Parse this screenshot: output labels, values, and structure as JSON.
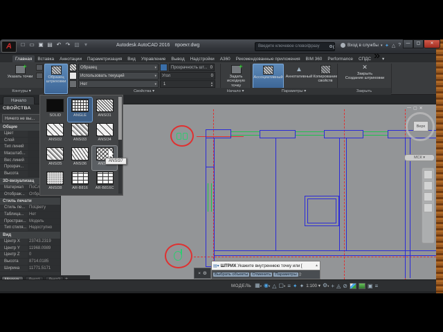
{
  "colors": {
    "accent_blue": "#4c7fb5",
    "axis_red": "#e03030",
    "wall_blue": "#2a2ad8",
    "window_green": "#1fc24d",
    "canvas_gray": "#939597"
  },
  "titlebar": {
    "app_letter": "A",
    "title": "Autodesk AutoCAD 2016",
    "filename": "проект.dwg",
    "search_placeholder": "Введите ключевое слово/фразу",
    "signin_label": "Вход в службы"
  },
  "ribbon_tabs": [
    {
      "label": "Главная",
      "active": true
    },
    {
      "label": "Вставка"
    },
    {
      "label": "Аннотации"
    },
    {
      "label": "Параметризация"
    },
    {
      "label": "Вид"
    },
    {
      "label": "Управление"
    },
    {
      "label": "Вывод"
    },
    {
      "label": "Надстройки"
    },
    {
      "label": "A360"
    },
    {
      "label": "Рекомендованные приложения"
    },
    {
      "label": "BIM 360"
    },
    {
      "label": "Performance"
    },
    {
      "label": "СПДС"
    }
  ],
  "ribbon": {
    "pick_points": "Указать точки",
    "contours_panel": "Контуры",
    "pattern_button": "Образец штриховки",
    "pattern_dropdown": "Образец",
    "use_current": "Использовать текущий",
    "none_option": "Нет",
    "transparency_label": "Прозрачность шт...",
    "transparency_value": "0",
    "angle_label": "Угол",
    "angle_value": "0",
    "scale_value": "1",
    "properties_panel": "Свойства",
    "set_origin": "Задать исходную точку",
    "origin_panel": "Начало",
    "associative": "Ассоциативный",
    "annotative": "Аннотативный",
    "match_properties": "Копирование свойств",
    "options_panel": "Параметры",
    "close_line1": "Закрыть",
    "close_line2": "Создание штриховки",
    "close_panel": "Закрыть"
  },
  "file_tabs": {
    "start_tab": "Начало"
  },
  "gallery": {
    "tooltip": "ANSI37",
    "items": [
      {
        "label": "SOLID",
        "pattern": "solid"
      },
      {
        "label": "ANGLE",
        "pattern": "grid",
        "selected": true
      },
      {
        "label": "ANSI31",
        "pattern": "diag1"
      },
      {
        "label": "ANSI32",
        "pattern": "diag2"
      },
      {
        "label": "ANSI33",
        "pattern": "diag3"
      },
      {
        "label": "ANSI34",
        "pattern": "diag4"
      },
      {
        "label": "ANSI35",
        "pattern": "diag3"
      },
      {
        "label": "ANSI36",
        "pattern": "diag5"
      },
      {
        "label": "ANSI37",
        "pattern": "cross",
        "hovered": true
      },
      {
        "label": "ANSI38",
        "pattern": "dots"
      },
      {
        "label": "AR-B816",
        "pattern": "brick"
      },
      {
        "label": "AR-B816C",
        "pattern": "brick"
      }
    ]
  },
  "properties_palette": {
    "title": "СВОЙСТВА",
    "selection": "Ничего не вы...",
    "sections": [
      {
        "header": "Общие",
        "rows": [
          [
            "Цвет",
            ""
          ],
          [
            "Слой",
            ""
          ],
          [
            "Тип линий",
            ""
          ],
          [
            "Масштаб...",
            ""
          ],
          [
            "Вес линий",
            ""
          ],
          [
            "Прозрач...",
            ""
          ],
          [
            "Высота",
            ""
          ]
        ]
      },
      {
        "header": "3D-визуализац",
        "rows": [
          [
            "Материал",
            "ПоСлою"
          ],
          [
            "Отображ...",
            "Отбрасыва..."
          ]
        ]
      },
      {
        "header": "Стиль печати",
        "rows": [
          [
            "Стиль пе...",
            "ПоЦвету"
          ],
          [
            "Таблица...",
            "Нет"
          ],
          [
            "Простран...",
            "Модель"
          ],
          [
            "Тип стиля...",
            "Недоступно"
          ]
        ]
      },
      {
        "header": "Вид",
        "rows": [
          [
            "Центр X",
            "23743.2319"
          ],
          [
            "Центр Y",
            "11968.0989"
          ],
          [
            "Центр Z",
            "0"
          ],
          [
            "Высота",
            "8714.0185"
          ],
          [
            "Ширина",
            "11771.5171"
          ]
        ]
      }
    ],
    "layout_tabs": [
      {
        "label": "Модель",
        "active": true
      },
      {
        "label": "Лист1"
      },
      {
        "label": "Лист2"
      }
    ]
  },
  "viewport": {
    "viewcube_face": "Верх",
    "wcs_label": "МСК"
  },
  "command": {
    "name": "ШТРИХ",
    "prompt": "Укажите внутреннюю точку или [",
    "options": [
      "Выбрать объекты",
      "Отменить",
      "Параметры"
    ],
    "suffix": "]:"
  },
  "statusbar": {
    "model_label": "МОДЕЛЬ",
    "scale": "1:100"
  }
}
